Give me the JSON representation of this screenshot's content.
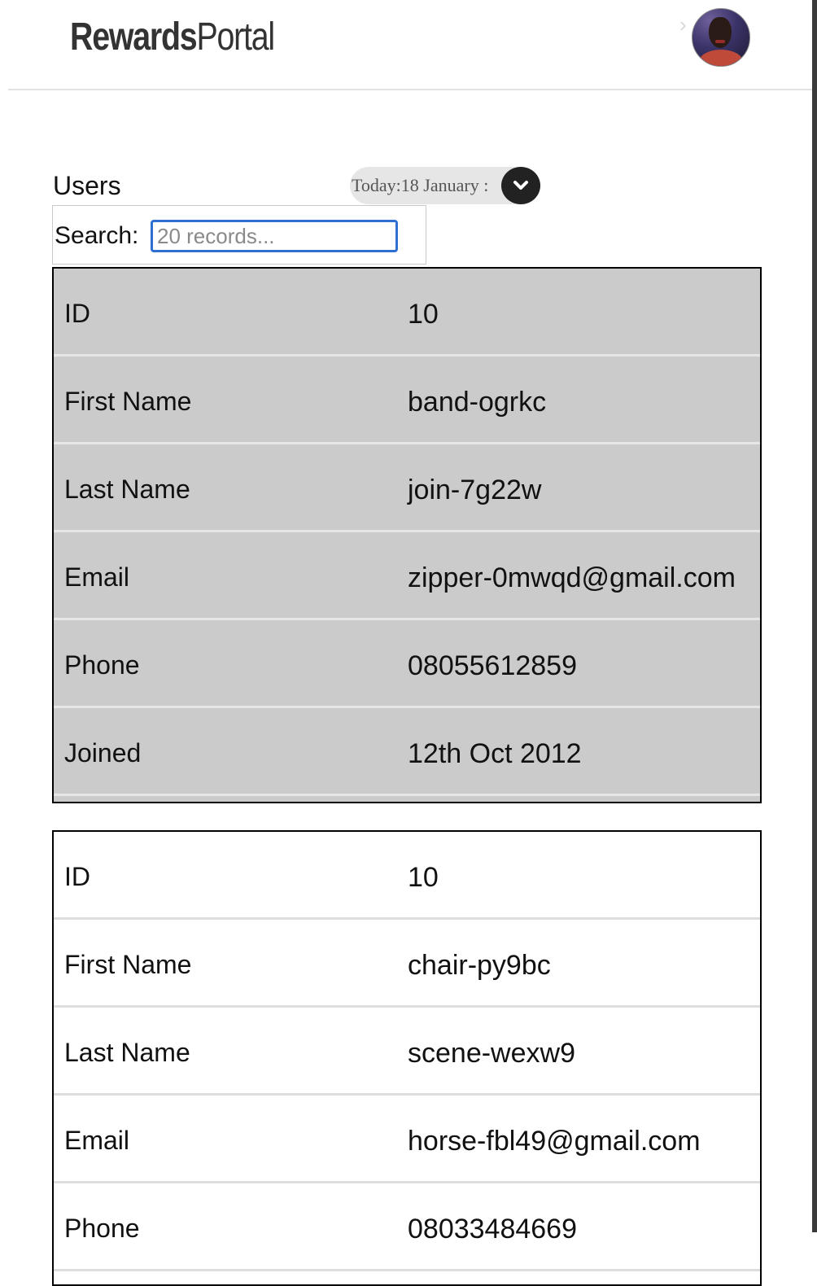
{
  "header": {
    "brand_bold": "Rewards",
    "brand_light": "Portal",
    "avatar_alt": "user avatar"
  },
  "users_section": {
    "title": "Users",
    "date_label": "Today:18 January :"
  },
  "search": {
    "label": "Search:",
    "placeholder": "20 records..."
  },
  "records": [
    {
      "highlighted": true,
      "fields": [
        {
          "label": "ID",
          "value": "10"
        },
        {
          "label": "First Name",
          "value": "band-ogrkc"
        },
        {
          "label": "Last Name",
          "value": "join-7g22w"
        },
        {
          "label": "Email",
          "value": "zipper-0mwqd@gmail.com"
        },
        {
          "label": "Phone",
          "value": "08055612859"
        },
        {
          "label": "Joined",
          "value": "12th Oct 2012"
        }
      ]
    },
    {
      "highlighted": false,
      "fields": [
        {
          "label": "ID",
          "value": "10"
        },
        {
          "label": "First Name",
          "value": "chair-py9bc"
        },
        {
          "label": "Last Name",
          "value": "scene-wexw9"
        },
        {
          "label": "Email",
          "value": "horse-fbl49@gmail.com"
        },
        {
          "label": "Phone",
          "value": "08033484669"
        }
      ]
    }
  ],
  "colors": {
    "highlight_bg": "#cbcbcb",
    "search_border": "#2f6fd1",
    "date_button": "#222222"
  }
}
